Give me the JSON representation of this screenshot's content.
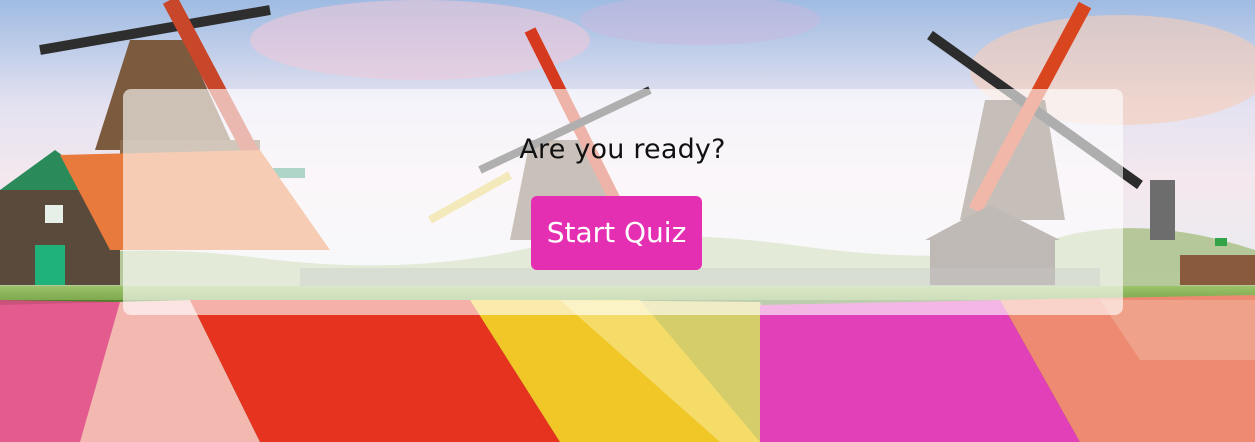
{
  "quiz_intro": {
    "question": "Are you ready?",
    "start_button_label": "Start Quiz"
  },
  "colors": {
    "button_accent": "#e52fb3",
    "button_text": "#ffffff",
    "card_overlay": "rgba(255,255,255,0.62)"
  },
  "background": {
    "scene": "dutch-windmills-tulip-field"
  }
}
